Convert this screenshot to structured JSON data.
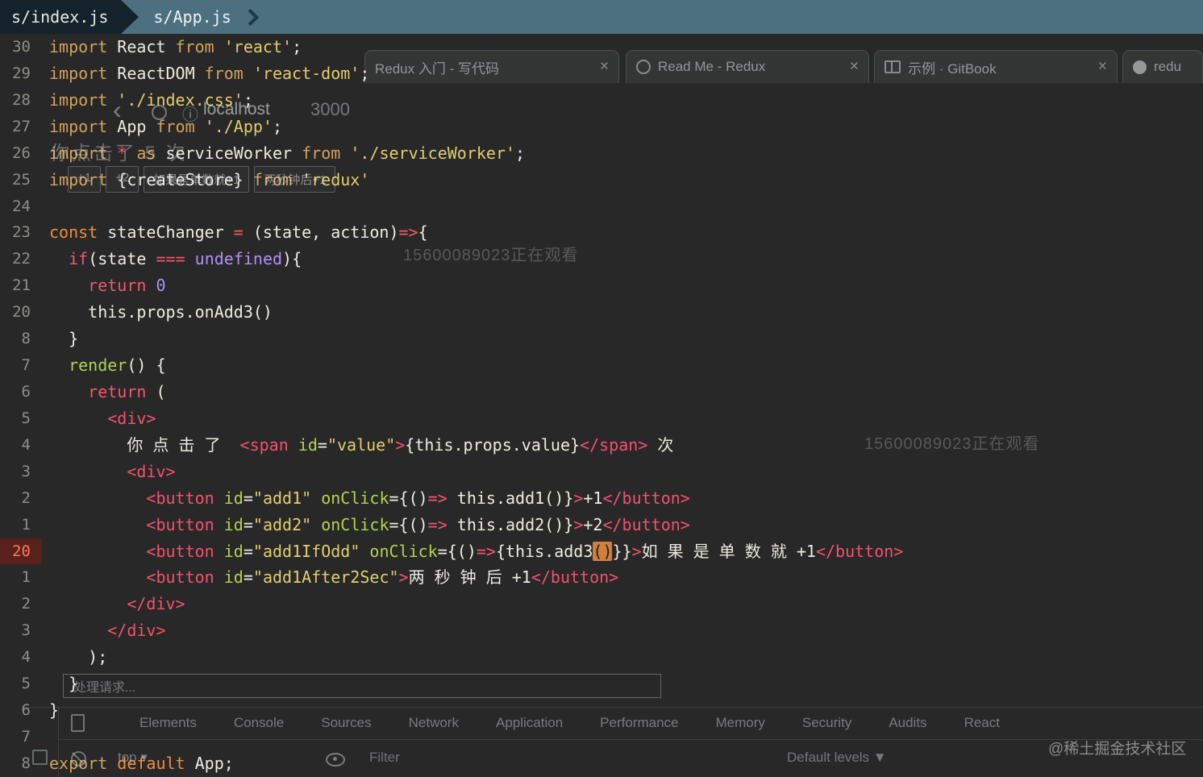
{
  "tabbar": {
    "tab1": "s/index.js",
    "tab2": "s/App.js"
  },
  "editor": {
    "highlight_color": "#cd8040",
    "lines": [
      {
        "num": "30",
        "tokens": [
          [
            "import",
            "imp"
          ],
          [
            " React ",
            "pl"
          ],
          [
            "from",
            "imp"
          ],
          [
            " ",
            "pl"
          ],
          [
            "'react'",
            "str"
          ],
          [
            ";",
            "pl"
          ]
        ]
      },
      {
        "num": "29",
        "tokens": [
          [
            "import",
            "imp"
          ],
          [
            " ReactDOM ",
            "pl"
          ],
          [
            "from",
            "imp"
          ],
          [
            " ",
            "pl"
          ],
          [
            "'react-dom'",
            "str"
          ],
          [
            ";",
            "pl"
          ]
        ]
      },
      {
        "num": "28",
        "tokens": [
          [
            "import",
            "imp"
          ],
          [
            " ",
            "pl"
          ],
          [
            "'./index.css'",
            "str"
          ],
          [
            ";",
            "pl"
          ]
        ]
      },
      {
        "num": "27",
        "tokens": [
          [
            "import",
            "imp"
          ],
          [
            " App ",
            "pl"
          ],
          [
            "from",
            "imp"
          ],
          [
            " ",
            "pl"
          ],
          [
            "'./App'",
            "str"
          ],
          [
            ";",
            "pl"
          ]
        ]
      },
      {
        "num": "26",
        "tokens": [
          [
            "import",
            "imp"
          ],
          [
            " ",
            "pl"
          ],
          [
            "*",
            "kwr"
          ],
          [
            " ",
            "pl"
          ],
          [
            "as",
            "imp"
          ],
          [
            " serviceWorker ",
            "pl"
          ],
          [
            "from",
            "imp"
          ],
          [
            " ",
            "pl"
          ],
          [
            "'./serviceWorker'",
            "str"
          ],
          [
            ";",
            "pl"
          ]
        ]
      },
      {
        "num": "25",
        "tokens": [
          [
            "import",
            "imp"
          ],
          [
            " {createStore} ",
            "pl"
          ],
          [
            "from",
            "imp"
          ],
          [
            " ",
            "pl"
          ],
          [
            "'redux'",
            "str"
          ]
        ]
      },
      {
        "num": "24",
        "tokens": []
      },
      {
        "num": "23",
        "tokens": [
          [
            "const",
            "kwo"
          ],
          [
            " stateChanger ",
            "pl"
          ],
          [
            "=",
            "kwr"
          ],
          [
            " (state, action)",
            "pl"
          ],
          [
            "=>",
            "kwr"
          ],
          [
            "{",
            "pl"
          ]
        ]
      },
      {
        "num": "22",
        "tokens": [
          [
            "  ",
            "pl"
          ],
          [
            "if",
            "kwr"
          ],
          [
            "(state ",
            "pl"
          ],
          [
            "===",
            "kwr"
          ],
          [
            " ",
            "pl"
          ],
          [
            "undefined",
            "und"
          ],
          [
            "){",
            "pl"
          ]
        ]
      },
      {
        "num": "21",
        "tokens": [
          [
            "    ",
            "pl"
          ],
          [
            "return",
            "kwr"
          ],
          [
            " ",
            "pl"
          ],
          [
            "0",
            "num"
          ]
        ]
      },
      {
        "num": "20",
        "tokens": [
          [
            "    this.props.onAdd3()",
            "pl"
          ]
        ]
      },
      {
        "num": "8",
        "tokens": [
          [
            "  }",
            "pl"
          ]
        ]
      },
      {
        "num": "7",
        "tokens": [
          [
            "  ",
            "pl"
          ],
          [
            "render",
            "attr"
          ],
          [
            "() {",
            "pl"
          ]
        ]
      },
      {
        "num": "6",
        "tokens": [
          [
            "    ",
            "pl"
          ],
          [
            "return",
            "kwr"
          ],
          [
            " (",
            "pl"
          ]
        ]
      },
      {
        "num": "5",
        "tokens": [
          [
            "      ",
            "pl"
          ],
          [
            "<div>",
            "tag"
          ]
        ]
      },
      {
        "num": "4",
        "tokens": [
          [
            "        你 点 击 了  ",
            "pl"
          ],
          [
            "<span",
            "tag"
          ],
          [
            " ",
            "pl"
          ],
          [
            "id",
            "attr"
          ],
          [
            "=",
            "pl"
          ],
          [
            "\"value\"",
            "str"
          ],
          [
            ">",
            "tag"
          ],
          [
            "{this.props.value}",
            "pl"
          ],
          [
            "</span>",
            "tag"
          ],
          [
            " 次",
            "pl"
          ]
        ]
      },
      {
        "num": "3",
        "tokens": [
          [
            "        ",
            "pl"
          ],
          [
            "<div>",
            "tag"
          ]
        ]
      },
      {
        "num": "2",
        "tokens": [
          [
            "          ",
            "pl"
          ],
          [
            "<button",
            "tag"
          ],
          [
            " ",
            "pl"
          ],
          [
            "id",
            "attr"
          ],
          [
            "=",
            "pl"
          ],
          [
            "\"add1\"",
            "str"
          ],
          [
            " ",
            "pl"
          ],
          [
            "onClick",
            "attr"
          ],
          [
            "={()",
            "pl"
          ],
          [
            "=>",
            "kwr"
          ],
          [
            " this.add1()}",
            "pl"
          ],
          [
            ">",
            "tag"
          ],
          [
            "+1",
            "pl"
          ],
          [
            "</button>",
            "tag"
          ]
        ]
      },
      {
        "num": "1",
        "tokens": [
          [
            "          ",
            "pl"
          ],
          [
            "<button",
            "tag"
          ],
          [
            " ",
            "pl"
          ],
          [
            "id",
            "attr"
          ],
          [
            "=",
            "pl"
          ],
          [
            "\"add2\"",
            "str"
          ],
          [
            " ",
            "pl"
          ],
          [
            "onClick",
            "attr"
          ],
          [
            "={()",
            "pl"
          ],
          [
            "=>",
            "kwr"
          ],
          [
            " this.add2()}",
            "pl"
          ],
          [
            ">",
            "tag"
          ],
          [
            "+2",
            "pl"
          ],
          [
            "</button>",
            "tag"
          ]
        ]
      },
      {
        "num": "20",
        "hl": true,
        "tokens": [
          [
            "          ",
            "pl"
          ],
          [
            "<button",
            "tag"
          ],
          [
            " ",
            "pl"
          ],
          [
            "id",
            "attr"
          ],
          [
            "=",
            "pl"
          ],
          [
            "\"add1IfOdd\"",
            "str"
          ],
          [
            " ",
            "pl"
          ],
          [
            "onClick",
            "attr"
          ],
          [
            "={()",
            "pl"
          ],
          [
            "=>",
            "kwr"
          ],
          [
            "{this.add3",
            "pl"
          ],
          [
            "()",
            "hl"
          ],
          [
            "}}",
            "pl"
          ],
          [
            ">",
            "tag"
          ],
          [
            "如 果 是 单 数 就 +1",
            "pl"
          ],
          [
            "</button>",
            "tag"
          ]
        ]
      },
      {
        "num": "1",
        "tokens": [
          [
            "          ",
            "pl"
          ],
          [
            "<button",
            "tag"
          ],
          [
            " ",
            "pl"
          ],
          [
            "id",
            "attr"
          ],
          [
            "=",
            "pl"
          ],
          [
            "\"add1After2Sec\"",
            "str"
          ],
          [
            ">",
            "tag"
          ],
          [
            "两 秒 钟 后 +1",
            "pl"
          ],
          [
            "</button>",
            "tag"
          ]
        ]
      },
      {
        "num": "2",
        "tokens": [
          [
            "        ",
            "pl"
          ],
          [
            "</div>",
            "tag"
          ]
        ]
      },
      {
        "num": "3",
        "tokens": [
          [
            "      ",
            "pl"
          ],
          [
            "</div>",
            "tag"
          ]
        ]
      },
      {
        "num": "4",
        "tokens": [
          [
            "    );",
            "pl"
          ]
        ]
      },
      {
        "num": "5",
        "tokens": [
          [
            "  }",
            "pl"
          ]
        ]
      },
      {
        "num": "6",
        "tokens": [
          [
            "}",
            "pl"
          ]
        ]
      },
      {
        "num": "7",
        "tokens": []
      },
      {
        "num": "8",
        "tokens": [
          [
            "export",
            "imp"
          ],
          [
            " ",
            "pl"
          ],
          [
            "default",
            "kwo"
          ],
          [
            " App;",
            "pl"
          ]
        ]
      }
    ]
  },
  "ghost": {
    "browser_tabs": [
      {
        "icon": "",
        "label": "Redux 入门 - 写代码",
        "close": "×"
      },
      {
        "icon": "redux",
        "label": "Read Me - Redux",
        "close": "×"
      },
      {
        "icon": "gitbook",
        "label": "示例 · GitBook",
        "close": "×"
      },
      {
        "icon": "github",
        "label": "redu",
        "close": ""
      }
    ],
    "nav": {
      "back": "‹",
      "info": "ⓘ",
      "url": "localhost",
      "port": "3000"
    },
    "page": {
      "clicked_text": "你点击了 5 次",
      "buttons": [
        "+1",
        "+2",
        "如果是单数就+1",
        "两秒钟后+1"
      ]
    },
    "watermark": "15600089023正在观看",
    "console_input": "处理请求...",
    "devtools_tabs": [
      "Elements",
      "Console",
      "Sources",
      "Network",
      "Application",
      "Performance",
      "Memory",
      "Security",
      "Audits",
      "React"
    ],
    "console_toolbar": {
      "context": "top",
      "context_caret": "▾",
      "filter_placeholder": "Filter",
      "levels": "Default levels",
      "levels_caret": "▼"
    },
    "site_watermark": "@稀土掘金技术社区"
  }
}
